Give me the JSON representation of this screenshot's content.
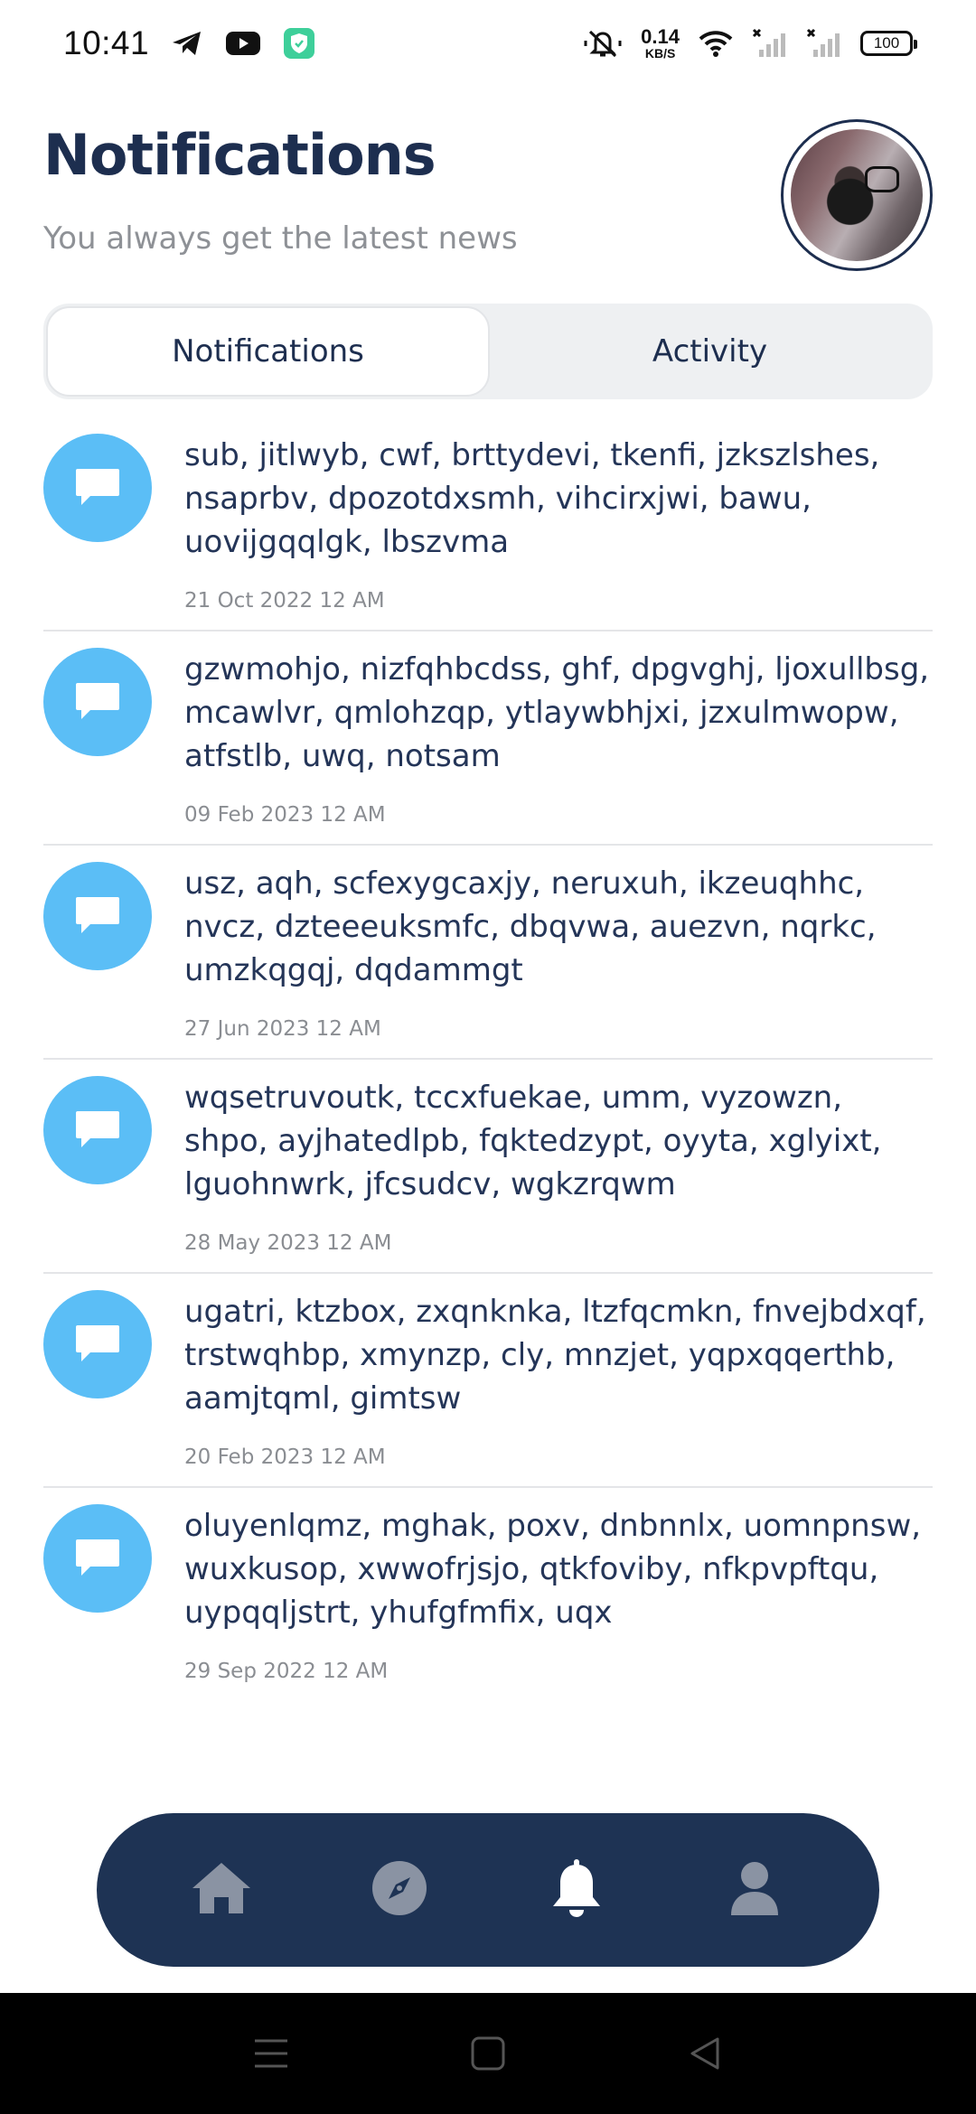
{
  "status_bar": {
    "time": "10:41",
    "net_speed_value": "0.14",
    "net_speed_unit": "KB/S",
    "battery": "100",
    "icons": [
      "telegram-icon",
      "youtube-icon",
      "vpn-shield-icon",
      "mute-icon",
      "wifi-icon",
      "signal-icon",
      "signal-icon"
    ]
  },
  "header": {
    "title": "Notifications",
    "subtitle": "You always get the latest news"
  },
  "tabs": [
    {
      "label": "Notifications",
      "active": true
    },
    {
      "label": "Activity",
      "active": false
    }
  ],
  "notifications": [
    {
      "text": "sub, jitlwyb, cwf, brttydevi, tkenfi, jzkszlshes, nsaprbv, dpozotdxsmh, vihcirxjwi, bawu, uovijgqqlgk, lbszvma",
      "date": "21 Oct 2022 12 AM",
      "icon": "chat-bubble-icon"
    },
    {
      "text": "gzwmohjo, nizfqhbcdss, ghf, dpgvghj, ljoxullbsg, mcawlvr, qmlohzqp, ytlaywbhjxi, jzxulmwopw, atfstlb, uwq, notsam",
      "date": "09 Feb 2023 12 AM",
      "icon": "chat-bubble-icon"
    },
    {
      "text": "usz, aqh, scfexygcaxjy, neruxuh, ikzeuqhhc, nvcz, dzteeeuksmfc, dbqvwa, auezvn, nqrkc, umzkqgqj, dqdammgt",
      "date": "27 Jun 2023 12 AM",
      "icon": "chat-bubble-icon"
    },
    {
      "text": "wqsetruvoutk, tccxfuekae, umm, vyzowzn, shpo, ayjhatedlpb, fqktedzypt, oyyta, xglyixt, lguohnwrk, jfcsudcv, wgkzrqwm",
      "date": "28 May 2023 12 AM",
      "icon": "chat-bubble-icon"
    },
    {
      "text": "ugatri, ktzbox, zxqnknka, ltzfqcmkn, fnvejbdxqf, trstwqhbp, xmynzp, cly, mnzjet, yqpxqqerthb, aamjtqml, gimtsw",
      "date": "20 Feb 2023 12 AM",
      "icon": "chat-bubble-icon"
    },
    {
      "text": "oluyenlqmz, mghak, poxv, dnbnnlx, uomnpnsw, wuxkusop, xwwofrjsjo, qtkfoviby, nfkpvpftqu, uypqqljstrt, yhufgfmfix, uqx",
      "date": "29 Sep 2022 12 AM",
      "icon": "chat-bubble-icon"
    }
  ],
  "bottom_nav": {
    "items": [
      {
        "icon": "home-icon",
        "active": false
      },
      {
        "icon": "compass-icon",
        "active": false
      },
      {
        "icon": "bell-icon",
        "active": true
      },
      {
        "icon": "user-icon",
        "active": false
      }
    ],
    "active_color": "#ffffff",
    "inactive_color": "#8a93a3",
    "background": "#1e3354"
  },
  "colors": {
    "accent_blue": "#5bbef6",
    "title_navy": "#1d2e4f"
  }
}
